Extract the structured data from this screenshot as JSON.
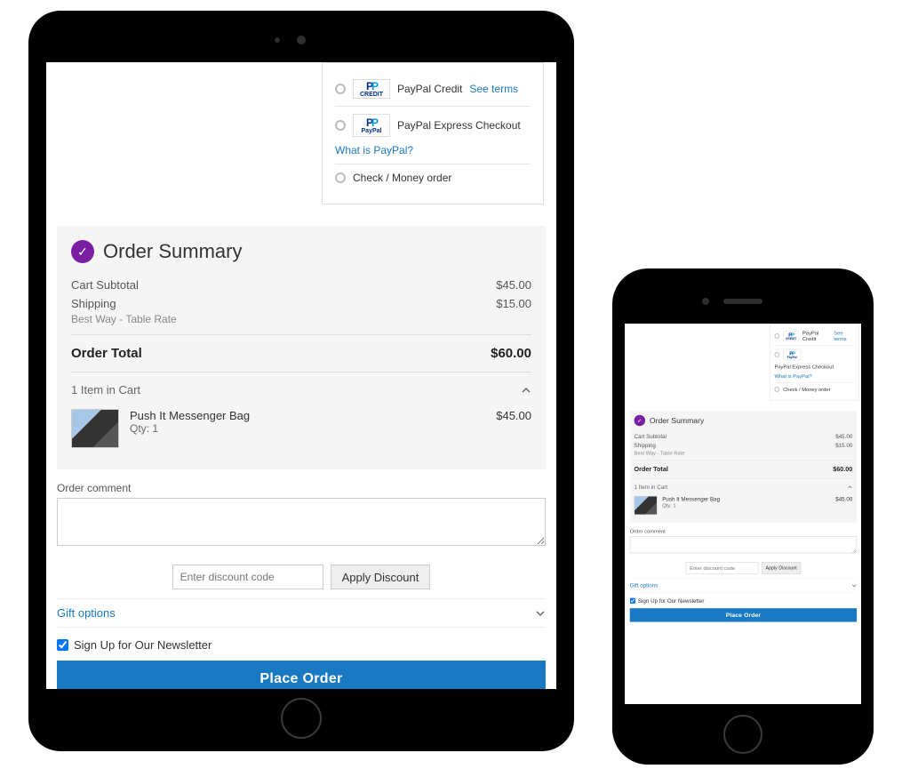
{
  "payment": {
    "options": [
      {
        "label": "PayPal Credit",
        "link_text": "See terms",
        "logo_kind": "credit"
      },
      {
        "label": "PayPal Express Checkout",
        "link_text": "",
        "logo_kind": "paypal"
      },
      {
        "label": "Check / Money order",
        "link_text": "",
        "logo_kind": "none"
      }
    ],
    "what_is_paypal": "What is PayPal?"
  },
  "summary": {
    "title": "Order Summary",
    "subtotal_label": "Cart Subtotal",
    "subtotal_value": "$45.00",
    "shipping_label": "Shipping",
    "shipping_value": "$15.00",
    "shipping_method": "Best Way - Table Rate",
    "total_label": "Order Total",
    "total_value": "$60.00",
    "items_label": "1 Item in Cart",
    "item": {
      "name": "Push It Messenger Bag",
      "qty_label": "Qty: 1",
      "price": "$45.00"
    }
  },
  "below": {
    "comment_label": "Order comment",
    "discount_placeholder": "Enter discount code",
    "apply_discount": "Apply Discount",
    "gift_options": "Gift options",
    "newsletter": "Sign Up for Our Newsletter",
    "place_order": "Place Order"
  }
}
